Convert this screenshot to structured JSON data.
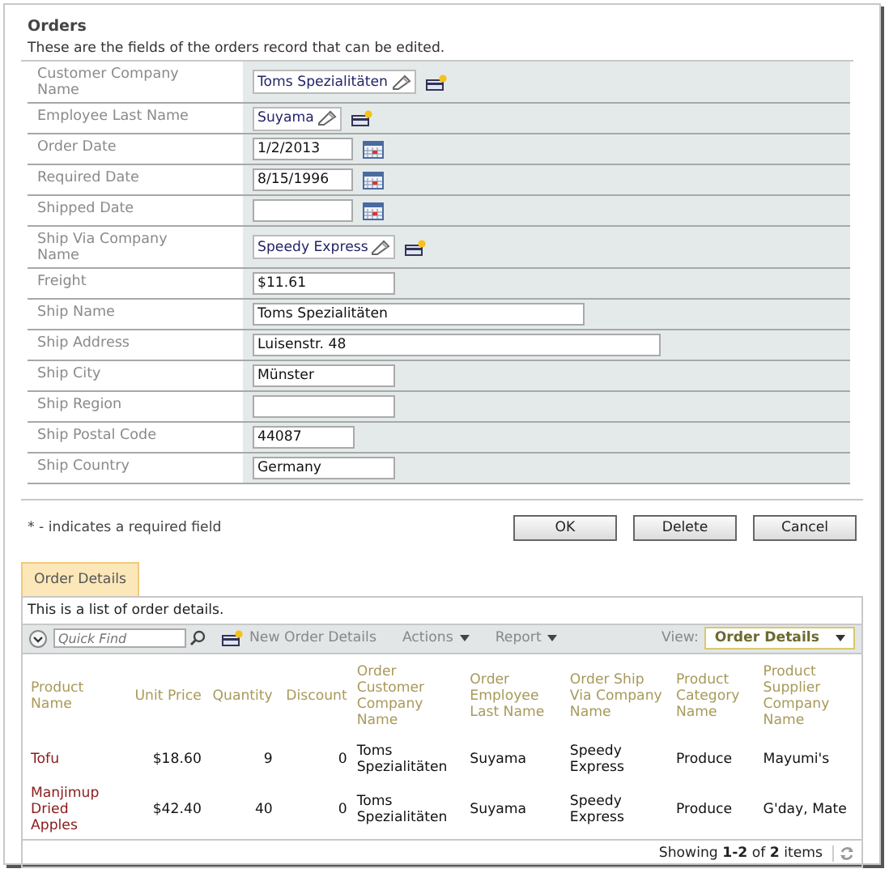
{
  "form": {
    "title": "Orders",
    "description": "These are the fields of the orders record that can be edited.",
    "fields": [
      {
        "label": "Customer Company Name",
        "kind": "lookup",
        "value": "Toms Spezialitäten"
      },
      {
        "label": "Employee Last Name",
        "kind": "lookup",
        "value": "Suyama"
      },
      {
        "label": "Order Date",
        "kind": "date",
        "value": "1/2/2013"
      },
      {
        "label": "Required Date",
        "kind": "date",
        "value": "8/15/1996"
      },
      {
        "label": "Shipped Date",
        "kind": "date"
      },
      {
        "label": "Ship Via Company Name",
        "kind": "lookup",
        "value": "Speedy Express"
      },
      {
        "label": "Freight",
        "kind": "text",
        "value": "$11.61"
      },
      {
        "label": "Ship Name",
        "kind": "long",
        "value": "Toms Spezialitäten"
      },
      {
        "label": "Ship Address",
        "kind": "wide",
        "value": "Luisenstr. 48"
      },
      {
        "label": "Ship City",
        "kind": "text",
        "value": "Münster"
      },
      {
        "label": "Ship Region",
        "kind": "text"
      },
      {
        "label": "Ship Postal Code",
        "kind": "short",
        "value": "44087"
      },
      {
        "label": "Ship Country",
        "kind": "text",
        "value": "Germany"
      }
    ],
    "footnote": "* - indicates a required field",
    "buttons": [
      "OK",
      "Delete",
      "Cancel"
    ]
  },
  "details": {
    "tabs": [
      {
        "label": "Order Details",
        "selected": true
      }
    ],
    "description": "This is a list of order details.",
    "toolbar": {
      "search_placeholder": "Quick Find",
      "new_label": "New Order Details",
      "menus": [
        "Actions",
        "Report"
      ],
      "view_label": "View:",
      "view_value": "Order Details"
    },
    "table": {
      "columns": [
        {
          "label": "Product Name",
          "kind": "link"
        },
        {
          "label": "Unit Price",
          "kind": "number"
        },
        {
          "label": "Quantity",
          "kind": "number"
        },
        {
          "label": "Discount",
          "kind": "number"
        },
        {
          "label": "Order Customer Company Name",
          "kind": "text"
        },
        {
          "label": "Order Employee Last Name",
          "kind": "text"
        },
        {
          "label": "Order Ship Via Company Name",
          "kind": "text"
        },
        {
          "label": "Product Category Name",
          "kind": "text"
        },
        {
          "label": "Product Supplier Company Name",
          "kind": "text"
        }
      ],
      "rows": [
        [
          "Tofu",
          "$18.60",
          "9",
          "0",
          "Toms Spezialitäten",
          "Suyama",
          "Speedy Express",
          "Produce",
          "Mayumi's"
        ],
        [
          "Manjimup Dried Apples",
          "$42.40",
          "40",
          "0",
          "Toms Spezialitäten",
          "Suyama",
          "Speedy Express",
          "Produce",
          "G'day, Mate"
        ]
      ]
    },
    "status": "Showing **1-2** of **2** items"
  }
}
